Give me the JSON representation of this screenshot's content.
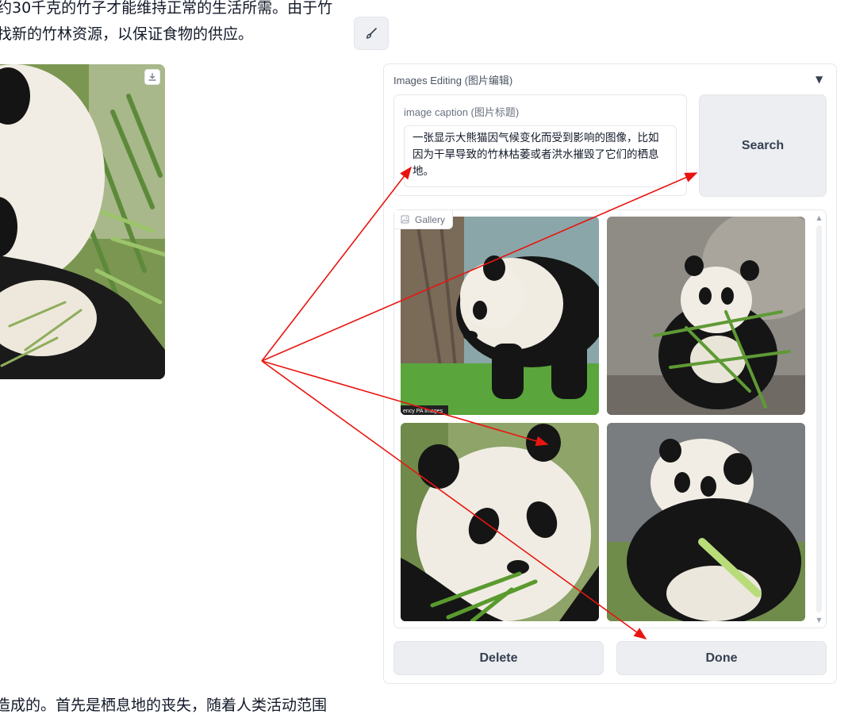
{
  "document": {
    "line_1": "约30千克的竹子才能维持正常的生活所需。由于竹",
    "line_2": "找新的竹林资源，以保证食物的供应。",
    "line_3": "造成的。首先是栖息地的丧失，随着人类活动范围"
  },
  "editor": {
    "panel_title": "Images Editing (图片编辑)",
    "collapse_icon": "triangle-down-icon",
    "caption_label": "image caption (图片标题)",
    "caption_value": "一张显示大熊猫因气候变化而受到影响的图像，比如因为干旱导致的竹林枯萎或者洪水摧毁了它们的栖息地。",
    "search_label": "Search",
    "gallery_label": "Gallery",
    "delete_label": "Delete",
    "done_label": "Done"
  },
  "icons": {
    "edit": "brush-icon",
    "download": "download-icon",
    "gallery": "image-icon"
  },
  "colors": {
    "annotation_arrow": "#e8150f",
    "button_bg": "#eceef1",
    "border": "#e5e7eb"
  }
}
